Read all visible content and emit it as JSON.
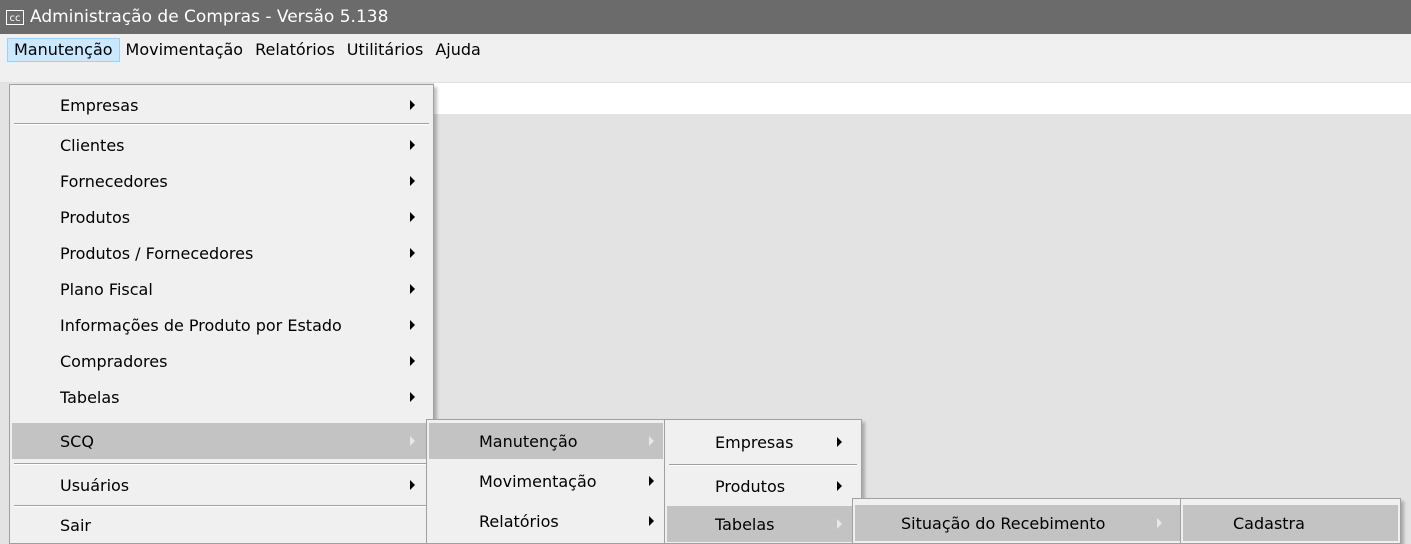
{
  "window": {
    "icon_text": "cc",
    "title": "Administração de Compras - Versão 5.138"
  },
  "menubar": [
    "Manutenção",
    "Movimentação",
    "Relatórios",
    "Utilitários",
    "Ajuda"
  ],
  "menu1": [
    "Empresas",
    "Clientes",
    "Fornecedores",
    "Produtos",
    "Produtos / Fornecedores",
    "Plano Fiscal",
    "Informações de Produto por Estado",
    "Compradores",
    "Tabelas",
    "SCQ",
    "Usuários",
    "Sair"
  ],
  "menu2": [
    "Manutenção",
    "Movimentação",
    "Relatórios"
  ],
  "menu3": [
    "Empresas",
    "Produtos",
    "Tabelas"
  ],
  "menu4": [
    "Situação do Recebimento"
  ],
  "menu5": [
    "Cadastra"
  ],
  "colors": {
    "titlebar": "#6b6b6b",
    "menu_bg": "#f0f0f0",
    "highlight": "#c3c3c3",
    "menubar_active": "#cce8ff"
  }
}
